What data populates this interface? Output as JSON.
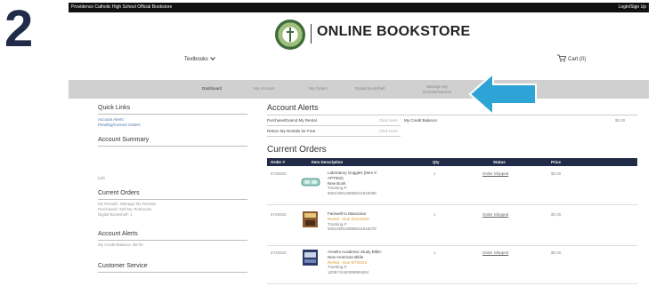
{
  "step": "2",
  "topbar": {
    "school": "Providence Catholic High School Official Bookstore",
    "login": "Login/Sign Up"
  },
  "brand": {
    "title": "ONLINE BOOKSTORE",
    "logo_icon": "school-seal-icon"
  },
  "header": {
    "textbooks": "Textbooks",
    "cart": "Cart (0)"
  },
  "nav": {
    "dashboard": "Dashboard",
    "my_account": "My Account",
    "my_orders": "My Orders",
    "digital_bookshelf": "Digital Bookshelf",
    "manage_rentals_1": "Manage My",
    "manage_rentals_2": "Rentals/Returns"
  },
  "arrow_color": "#2ea3d6",
  "sidebar": {
    "quick_links": "Quick Links",
    "account_alerts_link": "Account Alerts",
    "pending_link": "Pending/Current Orders",
    "account_summary": "Account Summary",
    "summary_edit": "Edit",
    "current_orders": "Current Orders",
    "current_orders_text_1": "My Rentals: Manage My Rentals",
    "current_orders_text_2": "Purchased: Sell My Textbooks",
    "current_orders_text_3": "Digital Bookshelf: 1",
    "account_alerts": "Account Alerts",
    "credit_text": "My Credit Balance: $0.00",
    "customer_service": "Customer Service"
  },
  "alerts": {
    "title": "Account Alerts",
    "row1": "Purchase/Extend My Rental",
    "row2": "Return My Rentals for Free",
    "click_here": "Click Here",
    "credit_label": "My Credit Balance:",
    "credit_value": "$0.00"
  },
  "orders": {
    "title": "Current Orders",
    "headers": {
      "order": "Order #",
      "item": "Item Description",
      "qty": "Qty",
      "status": "Status",
      "price": "Price"
    },
    "rows": [
      {
        "order": "8749283",
        "l1": "Laboratory Goggles (Item #:",
        "l2": "APT062)",
        "l3": "New Book",
        "l4": "Tracking #:",
        "l5": "9261290128065011623058",
        "qty": "1",
        "status": "Order Shipped",
        "price": "$0.00"
      },
      {
        "order": "8749283",
        "l1": "Farewell to Manzanar",
        "l2": "Rental - Due 5/31/2023",
        "l3": "Tracking #:",
        "l4": "9261290128065011618278",
        "l5": "",
        "qty": "1",
        "status": "Order Shipped",
        "price": "$0.00"
      },
      {
        "order": "8749283",
        "l1": "Anselm Academic Study Bible:",
        "l2": "New American Bible",
        "l3": "Rental - Due 6/7/2023",
        "l4": "Tracking #:",
        "l5": "1Z09Y3A50399981554",
        "qty": "1",
        "status": "Order Shipped",
        "price": "$0.00"
      }
    ]
  }
}
